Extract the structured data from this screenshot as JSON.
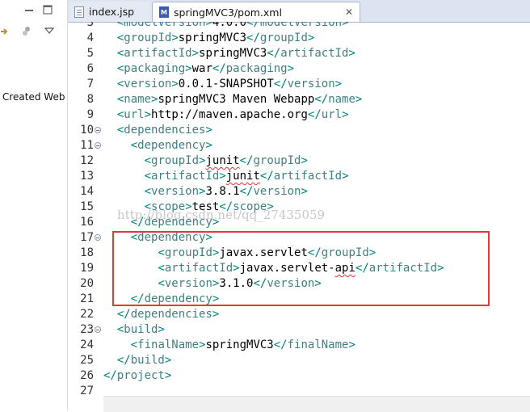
{
  "left_panel": {
    "restore_icon": "restore-icon",
    "maximize_icon": "maximize-icon",
    "text": "Created Web"
  },
  "tabs": [
    {
      "label": "index.jsp",
      "icon": "jsp-file-icon"
    },
    {
      "label": "springMVC3/pom.xml",
      "icon": "maven-pom-icon"
    }
  ],
  "watermark": "http://blog.csdn.net/qq_27435059",
  "colors": {
    "tag": "#3f7f7f",
    "punct": "#008080",
    "highlight": "#e23a3a"
  },
  "lines": [
    {
      "n": "3",
      "indent": "  ",
      "open": "modelVersion",
      "text": "4.0.0",
      "close": "modelVersion"
    },
    {
      "n": "4",
      "indent": "  ",
      "open": "groupId",
      "text": "springMVC3",
      "close": "groupId"
    },
    {
      "n": "5",
      "indent": "  ",
      "open": "artifactId",
      "text": "springMVC3",
      "close": "artifactId"
    },
    {
      "n": "6",
      "indent": "  ",
      "open": "packaging",
      "text": "war",
      "close": "packaging"
    },
    {
      "n": "7",
      "indent": "  ",
      "open": "version",
      "text": "0.0.1-SNAPSHOT",
      "close": "version"
    },
    {
      "n": "8",
      "indent": "  ",
      "open": "name",
      "text": "springMVC3 Maven Webapp",
      "close": "name"
    },
    {
      "n": "9",
      "indent": "  ",
      "open": "url",
      "text": "http://maven.apache.org",
      "close": "url"
    },
    {
      "n": "10",
      "fold": true,
      "indent": "  ",
      "open": "dependencies"
    },
    {
      "n": "11",
      "fold": true,
      "indent": "    ",
      "open": "dependency"
    },
    {
      "n": "12",
      "indent": "      ",
      "open": "groupId",
      "text": "junit",
      "close": "groupId",
      "spell": true
    },
    {
      "n": "13",
      "indent": "      ",
      "open": "artifactId",
      "text": "junit",
      "close": "artifactId",
      "spell": true
    },
    {
      "n": "14",
      "indent": "      ",
      "open": "version",
      "text": "3.8.1",
      "close": "version"
    },
    {
      "n": "15",
      "indent": "      ",
      "open": "scope",
      "text": "test",
      "close": "scope"
    },
    {
      "n": "16",
      "indent": "    ",
      "close": "dependency"
    },
    {
      "n": "17",
      "fold": true,
      "indent": "    ",
      "open": "dependency"
    },
    {
      "n": "18",
      "indent": "        ",
      "open": "groupId",
      "text": "javax.servlet",
      "close": "groupId"
    },
    {
      "n": "19",
      "indent": "        ",
      "open": "artifactId",
      "text": "javax.servlet-api",
      "close": "artifactId",
      "spell_part": "api"
    },
    {
      "n": "20",
      "indent": "        ",
      "open": "version",
      "text": "3.1.0",
      "close": "version"
    },
    {
      "n": "21",
      "indent": "    ",
      "close": "dependency"
    },
    {
      "n": "22",
      "indent": "  ",
      "close": "dependencies"
    },
    {
      "n": "23",
      "fold": true,
      "indent": "  ",
      "open": "build"
    },
    {
      "n": "24",
      "indent": "    ",
      "open": "finalName",
      "text": "springMVC3",
      "close": "finalName"
    },
    {
      "n": "25",
      "indent": "  ",
      "close": "build"
    },
    {
      "n": "26",
      "indent": "",
      "close": "project"
    },
    {
      "n": "27",
      "indent": ""
    }
  ]
}
